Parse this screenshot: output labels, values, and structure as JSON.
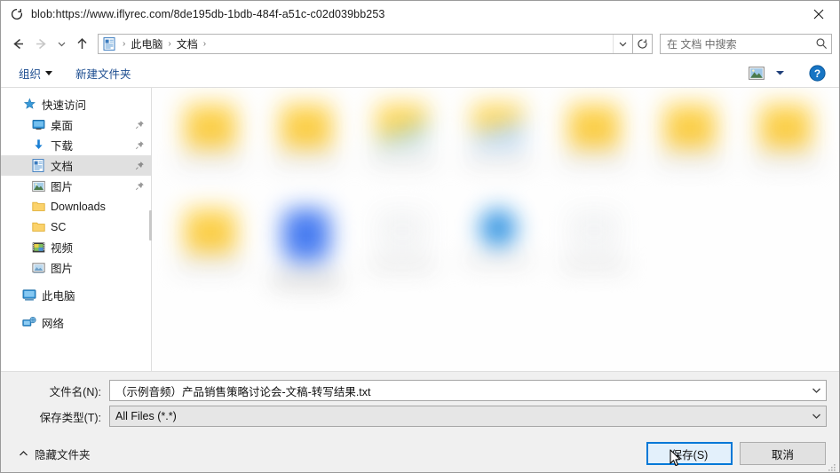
{
  "titlebar": {
    "icon": "page-blob-icon",
    "title": "blob:https://www.iflyrec.com/8de195db-1bdb-484f-a51c-c02d039bb253",
    "close_label": "×"
  },
  "nav": {
    "back": "back-arrow",
    "forward": "forward-arrow",
    "recent": "recent-chevron",
    "up": "up-arrow",
    "breadcrumb": {
      "icon": "documents-icon",
      "items": [
        "此电脑",
        "文档"
      ],
      "separator": "›",
      "trailing_separator": "›"
    },
    "address_dropdown": "chevron-down",
    "refresh": "refresh-icon",
    "search": {
      "placeholder": "在 文档 中搜索",
      "icon": "search-icon"
    }
  },
  "toolbar": {
    "organize_label": "组织",
    "new_folder_label": "新建文件夹",
    "view_icon": "thumbnail-view-icon",
    "view_caret": "chevron-down",
    "help_icon": "help-icon"
  },
  "sidebar": {
    "items": [
      {
        "label": "快速访问",
        "icon": "star-icon",
        "level": 0,
        "pinned": false,
        "selected": false
      },
      {
        "label": "桌面",
        "icon": "desktop-icon",
        "level": 1,
        "pinned": true,
        "selected": false
      },
      {
        "label": "下载",
        "icon": "download-icon",
        "level": 1,
        "pinned": true,
        "selected": false
      },
      {
        "label": "文档",
        "icon": "documents-icon",
        "level": 1,
        "pinned": true,
        "selected": true
      },
      {
        "label": "图片",
        "icon": "pictures-icon",
        "level": 1,
        "pinned": true,
        "selected": false
      },
      {
        "label": "Downloads",
        "icon": "folder-icon",
        "level": 1,
        "pinned": false,
        "selected": false
      },
      {
        "label": "SC",
        "icon": "folder-icon",
        "level": 1,
        "pinned": false,
        "selected": false
      },
      {
        "label": "视频",
        "icon": "video-icon",
        "level": 1,
        "pinned": false,
        "selected": false
      },
      {
        "label": "图片",
        "icon": "photo-icon",
        "level": 1,
        "pinned": false,
        "selected": false
      },
      {
        "label": "此电脑",
        "icon": "this-pc-icon",
        "level": 0,
        "pinned": false,
        "selected": false,
        "gap_before": true
      },
      {
        "label": "网络",
        "icon": "network-icon",
        "level": 0,
        "pinned": false,
        "selected": false,
        "gap_before": true
      }
    ]
  },
  "file_grid": {
    "blurred": true,
    "items": [
      {
        "icon": "folder-icon",
        "style": "folder",
        "name_lines": 1
      },
      {
        "icon": "folder-icon",
        "style": "folder",
        "name_lines": 1
      },
      {
        "icon": "folder-doc-icon",
        "style": "folder-doc",
        "name_lines": 1
      },
      {
        "icon": "folder-blue-icon",
        "style": "folder-blue",
        "name_lines": 1
      },
      {
        "icon": "folder-icon",
        "style": "folder",
        "name_lines": 1
      },
      {
        "icon": "folder-icon",
        "style": "folder",
        "name_lines": 1
      },
      {
        "icon": "folder-icon",
        "style": "folder",
        "name_lines": 1
      },
      {
        "icon": "folder-icon",
        "style": "folder",
        "name_lines": 1
      },
      {
        "icon": "app-blue-icon",
        "style": "app-blue",
        "name_lines": 2
      },
      {
        "icon": "faint-file-icon",
        "style": "faint",
        "name_lines": 1
      },
      {
        "icon": "circle-blue-icon",
        "style": "circle-blue",
        "name_lines": 1
      },
      {
        "icon": "faint-file-icon",
        "style": "faint",
        "name_lines": 1
      }
    ]
  },
  "form": {
    "filename_label": "文件名(N):",
    "filename_value": "（示例音频）产品销售策略讨论会-文稿-转写结果.txt",
    "filetype_label": "保存类型(T):",
    "filetype_value": "All Files (*.*)",
    "dropdown_icon": "chevron-down"
  },
  "footer": {
    "hide_folders_label": "隐藏文件夹",
    "hide_folders_icon": "chevron-up",
    "save_label": "保存(S)",
    "cancel_label": "取消",
    "resize_grip": "resize-grip-icon",
    "cursor": "mouse-pointer"
  },
  "colors": {
    "accent": "#0078d7",
    "selection": "#e0e0e0",
    "toolbar_link": "#1a4b8f",
    "chrome_bg": "#f0f0f0",
    "folder_yellow": "#f7c32e"
  }
}
